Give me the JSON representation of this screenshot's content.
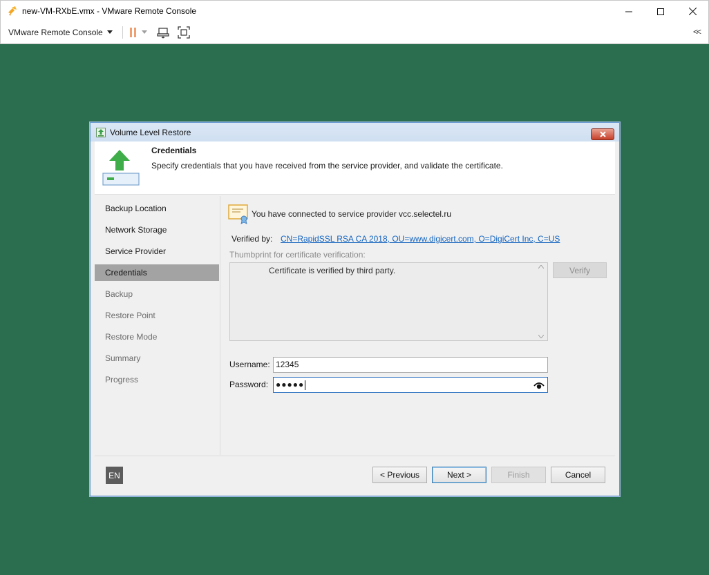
{
  "window": {
    "title": "new-VM-RXbE.vmx - VMware Remote Console",
    "minimize_icon": "minimize-icon",
    "maximize_icon": "maximize-icon",
    "close_icon": "close-icon"
  },
  "toolbar": {
    "menu_label": "VMware Remote Console",
    "collapse_label": "<<"
  },
  "dialog": {
    "title": "Volume Level Restore",
    "close_label": "x",
    "header": {
      "title": "Credentials",
      "description": "Specify credentials that you have received from the service provider, and validate the certificate."
    },
    "steps": [
      {
        "label": "Backup Location",
        "state": "done"
      },
      {
        "label": "Network Storage",
        "state": "done"
      },
      {
        "label": "Service Provider",
        "state": "done"
      },
      {
        "label": "Credentials",
        "state": "active"
      },
      {
        "label": "Backup",
        "state": "pending"
      },
      {
        "label": "Restore Point",
        "state": "pending"
      },
      {
        "label": "Restore Mode",
        "state": "pending"
      },
      {
        "label": "Summary",
        "state": "pending"
      },
      {
        "label": "Progress",
        "state": "pending"
      }
    ],
    "content": {
      "connected_text": "You have connected to service provider vcc.selectel.ru",
      "verified_by_label": "Verified by:",
      "verified_by_link": "CN=RapidSSL RSA CA 2018, OU=www.digicert.com, O=DigiCert Inc, C=US",
      "thumbprint_label": "Thumbprint for certificate verification:",
      "thumbprint_text": "Certificate is verified by third party.",
      "verify_button": "Verify",
      "username_label": "Username:",
      "username_value": "12345",
      "password_label": "Password:",
      "password_dots": "●●●●●"
    },
    "footer": {
      "language": "EN",
      "previous_button": "< Previous",
      "next_button": "Next >",
      "finish_button": "Finish",
      "cancel_button": "Cancel"
    }
  },
  "colors": {
    "desktop": "#2b6e4f",
    "active_step": "#a3a3a3",
    "link": "#1565c0",
    "accent_green": "#4caf50"
  }
}
